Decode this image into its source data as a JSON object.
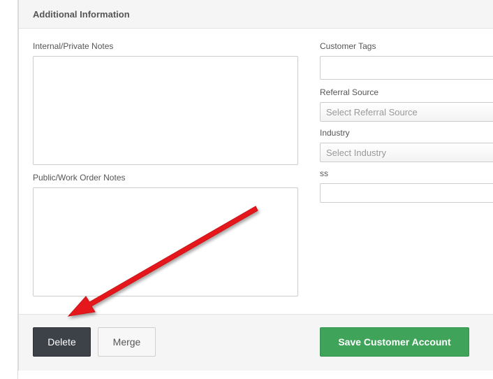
{
  "section": {
    "title": "Additional Information"
  },
  "fields": {
    "internal_notes_label": "Internal/Private Notes",
    "internal_notes_value": "",
    "public_notes_label": "Public/Work Order Notes",
    "public_notes_value": "",
    "customer_tags_label": "Customer Tags",
    "customer_tags_value": "",
    "referral_source_label": "Referral Source",
    "referral_source_placeholder": "Select Referral Source",
    "industry_label": "Industry",
    "industry_placeholder": "Select Industry",
    "ss_label": "ss",
    "ss_value": ""
  },
  "footer": {
    "delete_label": "Delete",
    "merge_label": "Merge",
    "save_label": "Save Customer Account"
  },
  "colors": {
    "delete_bg": "#3d4148",
    "save_bg": "#3fa35a",
    "annotation_arrow": "#e5191c"
  },
  "icons": {
    "annotation": "red-arrow-pointing-to-delete"
  }
}
